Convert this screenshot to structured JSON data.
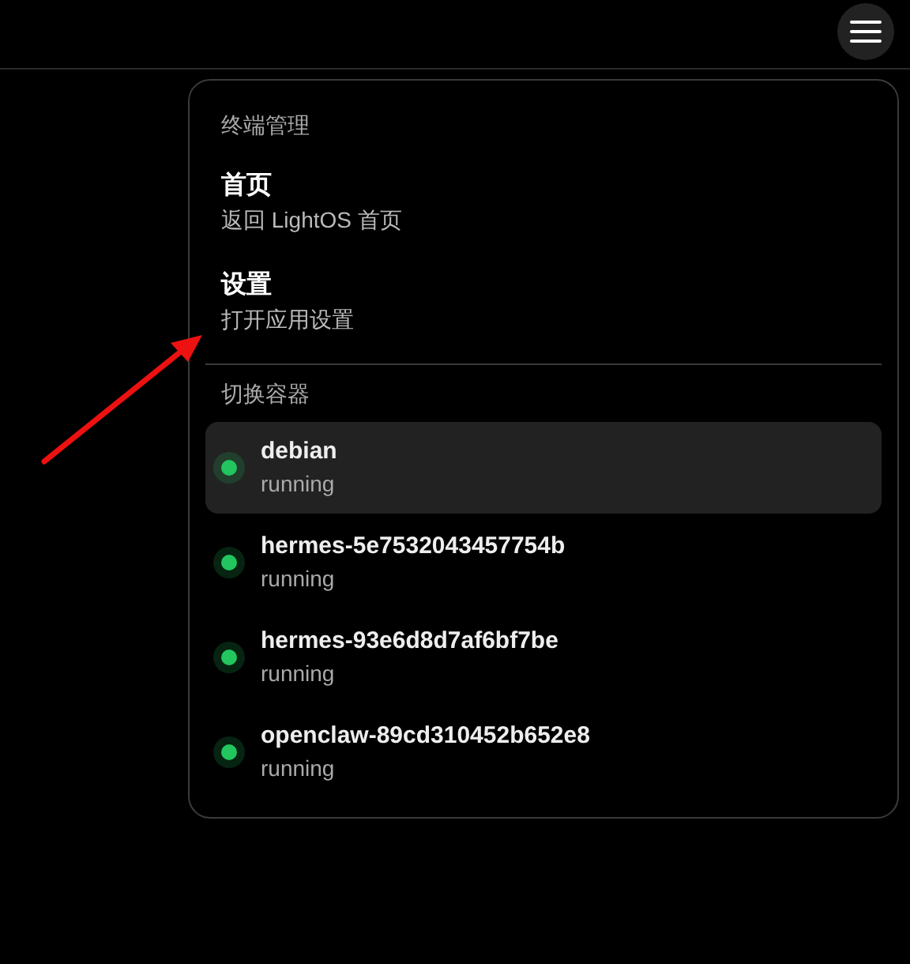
{
  "menu": {
    "sections": [
      {
        "heading": "终端管理",
        "items": [
          {
            "title": "首页",
            "description": "返回 LightOS 首页"
          },
          {
            "title": "设置",
            "description": "打开应用设置"
          }
        ]
      },
      {
        "heading": "切换容器",
        "containers": [
          {
            "name": "debian",
            "status": "running",
            "selected": true,
            "color": "#22c55e"
          },
          {
            "name": "hermes-5e7532043457754b",
            "status": "running",
            "selected": false,
            "color": "#22c55e"
          },
          {
            "name": "hermes-93e6d8d7af6bf7be",
            "status": "running",
            "selected": false,
            "color": "#22c55e"
          },
          {
            "name": "openclaw-89cd310452b652e8",
            "status": "running",
            "selected": false,
            "color": "#22c55e"
          }
        ]
      }
    ]
  }
}
